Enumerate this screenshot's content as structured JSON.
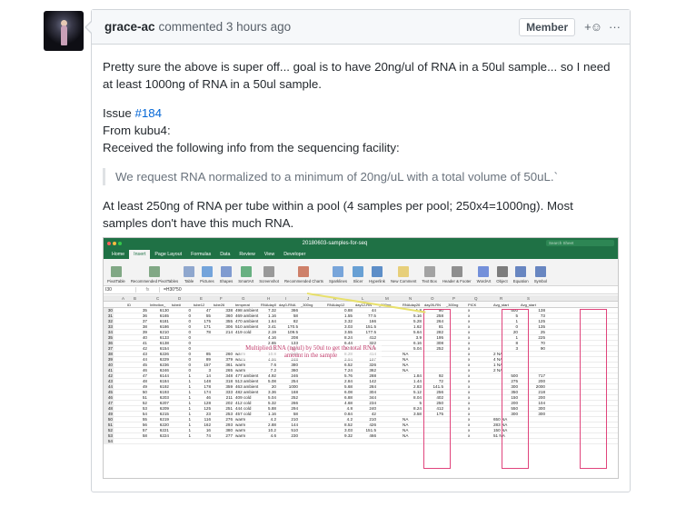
{
  "comment": {
    "author": "grace-ac",
    "action": "commented",
    "time": "3 hours ago",
    "badge": "Member",
    "reaction_label": "+☺",
    "menu_label": "···",
    "para1": "Pretty sure the above is super off... goal is to have 20ng/ul of RNA in a 50ul sample... so I need at least 1000ng of RNA in a 50ul sample.",
    "issue_prefix": "Issue ",
    "issue_link": "#184",
    "from_line": "From kubu4:",
    "received_line": "Received the following info from the sequencing facility:",
    "quote": "We request RNA normalized to a minimum of 20ng/uL with a total volume of 50uL.`",
    "para3": "At least 250ng of RNA per tube within a pool (4 samples per pool; 250x4=1000ng). Most samples don't have this much RNA."
  },
  "excel": {
    "window_title": "20180603-samples-for-seq",
    "search_placeholder": "Search Sheet",
    "tabs": [
      "Home",
      "Insert",
      "Page Layout",
      "Formulas",
      "Data",
      "Review",
      "View",
      "Developer"
    ],
    "active_tab": "Insert",
    "ribbon": [
      "PivotTable",
      "Recommended PivotTables",
      "Table",
      "Pictures",
      "Shapes",
      "SmartArt",
      "Screenshot",
      "Recommended Charts",
      "Sparklines",
      "Slicer",
      "Hyperlink",
      "New Comment",
      "Text Box",
      "Header & Footer",
      "WordArt",
      "Object",
      "Equation",
      "Symbol"
    ],
    "name_box": "I30",
    "fx_label": "fx",
    "formula": "=H30*50",
    "col_letters": [
      "A",
      "B",
      "C",
      "D",
      "E",
      "F",
      "G",
      "H",
      "I",
      "J",
      "K",
      "L",
      "M",
      "N",
      "O",
      "P",
      "Q",
      "R",
      "S"
    ],
    "filter_headers": [
      "ID",
      "Infection_",
      "tube#",
      "tube12",
      "tube26",
      "temperat",
      "RNAday0",
      "day0-RNA",
      "_300ng",
      "RNAday12",
      "day12-RN",
      "_300ng",
      "RNAday26",
      "day26-RN",
      "_300ng",
      "PICK",
      "Avg_start",
      "Avg_start"
    ],
    "annotation": "Multiplied RNA (ng/ul) by 50ul to get the total RNA amount in the sample",
    "rows": [
      [
        "30",
        "35",
        "6130",
        "0",
        "47",
        "338",
        "498 ambient",
        "7.32",
        "366",
        "",
        "0.88",
        "44",
        "",
        "1.8",
        "90",
        "",
        "x",
        "500",
        "138"
      ],
      [
        "31",
        "36",
        "6165",
        "0",
        "55",
        "360",
        "469 ambient",
        "1.16",
        "58",
        "",
        "1.55",
        "77.5",
        "",
        "5.16",
        "258",
        "",
        "x",
        "5",
        "73"
      ],
      [
        "32",
        "37",
        "6181",
        "0",
        "175",
        "355",
        "470 ambient",
        "1.64",
        "82",
        "",
        "3.32",
        "166",
        "",
        "5.28",
        "264",
        "",
        "x",
        "1",
        "125"
      ],
      [
        "33",
        "38",
        "6186",
        "0",
        "171",
        "306",
        "510 ambient",
        "3.41",
        "170.5",
        "",
        "3.03",
        "151.5",
        "",
        "1.62",
        "81",
        "",
        "x",
        "0",
        "135"
      ],
      [
        "34",
        "39",
        "6210",
        "0",
        "78",
        "214",
        "419 cold",
        "2.19",
        "109.5",
        "",
        "3.55",
        "177.5",
        "",
        "5.64",
        "282",
        "",
        "x",
        "20",
        "25"
      ],
      [
        "35",
        "40",
        "6133",
        "0",
        "",
        "",
        "",
        "4.16",
        "208",
        "",
        "8.24",
        "412",
        "",
        "3.9",
        "195",
        "",
        "x",
        "1",
        "225"
      ],
      [
        "36",
        "41",
        "6138",
        "0",
        "",
        "",
        "",
        "2.65",
        "133",
        "",
        "6.44",
        "322",
        "",
        "6.16",
        "308",
        "",
        "x",
        "8",
        "70"
      ],
      [
        "37",
        "42",
        "6154",
        "0",
        "",
        "",
        "",
        "2.1",
        "105",
        "",
        "2.38",
        "119",
        "",
        "5.04",
        "252",
        "",
        "x",
        "3",
        "90"
      ],
      [
        "38",
        "43",
        "6226",
        "0",
        "85",
        "260",
        "warm",
        "10.8",
        "540",
        "",
        "8.28",
        "414",
        "",
        "NA",
        "",
        "",
        "x",
        "2 NA",
        ""
      ],
      [
        "39",
        "44",
        "6229",
        "0",
        "89",
        "379",
        "warm",
        "4.96",
        "248",
        "",
        "3.94",
        "197",
        "",
        "NA",
        "",
        "",
        "x",
        "4 NA",
        ""
      ],
      [
        "40",
        "45",
        "6236",
        "0",
        "157",
        "361",
        "warm",
        "7.6",
        "380",
        "",
        "6.52",
        "326",
        "",
        "NA",
        "",
        "",
        "x",
        "1 NA",
        ""
      ],
      [
        "41",
        "46",
        "6246",
        "0",
        "3",
        "265",
        "warm",
        "7.2",
        "360",
        "",
        "7.24",
        "362",
        "",
        "NA",
        "",
        "",
        "x",
        "2 NA",
        ""
      ],
      [
        "42",
        "47",
        "6144",
        "1",
        "14",
        "348",
        "477 ambient",
        "4.92",
        "246",
        "",
        "5.76",
        "288",
        "",
        "1.84",
        "92",
        "",
        "x",
        "500",
        "717"
      ],
      [
        "43",
        "48",
        "6184",
        "1",
        "148",
        "318",
        "513 ambient",
        "5.08",
        "254",
        "",
        "2.84",
        "142",
        "",
        "1.44",
        "72",
        "",
        "x",
        "275",
        "200"
      ],
      [
        "44",
        "49",
        "6192",
        "1",
        "178",
        "359",
        "463 ambient",
        "20",
        "1000",
        "",
        "5.68",
        "284",
        "",
        "2.83",
        "141.5",
        "",
        "x",
        "300",
        "2000"
      ],
      [
        "45",
        "50",
        "6193",
        "1",
        "174",
        "333",
        "482 ambient",
        "3.36",
        "168",
        "",
        "6.08",
        "304",
        "",
        "5.12",
        "256",
        "",
        "x",
        "350",
        "218"
      ],
      [
        "46",
        "51",
        "6203",
        "1",
        "46",
        "211",
        "409 cold",
        "5.04",
        "252",
        "",
        "6.88",
        "344",
        "",
        "8.04",
        "402",
        "",
        "x",
        "150",
        "200"
      ],
      [
        "47",
        "52",
        "6207",
        "1",
        "128",
        "202",
        "412 cold",
        "5.32",
        "266",
        "",
        "4.68",
        "234",
        "",
        "5",
        "250",
        "",
        "x",
        "200",
        "104"
      ],
      [
        "48",
        "53",
        "6209",
        "1",
        "125",
        "251",
        "444 cold",
        "5.88",
        "294",
        "",
        "4.8",
        "240",
        "",
        "8.24",
        "412",
        "",
        "x",
        "550",
        "300"
      ],
      [
        "49",
        "54",
        "6215",
        "1",
        "23",
        "253",
        "457 cold",
        "1.16",
        "58",
        "",
        "0.84",
        "42",
        "",
        "3.58",
        "175",
        "",
        "x",
        "300",
        "300"
      ],
      [
        "50",
        "55",
        "6219",
        "1",
        "116",
        "276",
        "warm",
        "4.2",
        "210",
        "",
        "4.2",
        "210",
        "",
        "NA",
        "",
        "",
        "x",
        "650 NA",
        ""
      ],
      [
        "51",
        "56",
        "6220",
        "1",
        "162",
        "293",
        "warm",
        "2.88",
        "144",
        "",
        "8.52",
        "426",
        "",
        "NA",
        "",
        "",
        "x",
        "283 NA",
        ""
      ],
      [
        "52",
        "57",
        "6221",
        "1",
        "16",
        "380",
        "warm",
        "10.2",
        "510",
        "",
        "3.03",
        "151.5",
        "",
        "NA",
        "",
        "",
        "x",
        "150 NA",
        ""
      ],
      [
        "53",
        "58",
        "6224",
        "1",
        "74",
        "277",
        "warm",
        "4.6",
        "230",
        "",
        "9.32",
        "466",
        "",
        "NA",
        "",
        "",
        "x",
        "51 NA",
        ""
      ],
      [
        "54",
        "",
        "",
        "",
        "",
        "",
        "",
        "",
        "",
        "",
        "",
        "",
        "",
        "",
        "",
        "",
        "",
        "",
        ""
      ]
    ]
  }
}
